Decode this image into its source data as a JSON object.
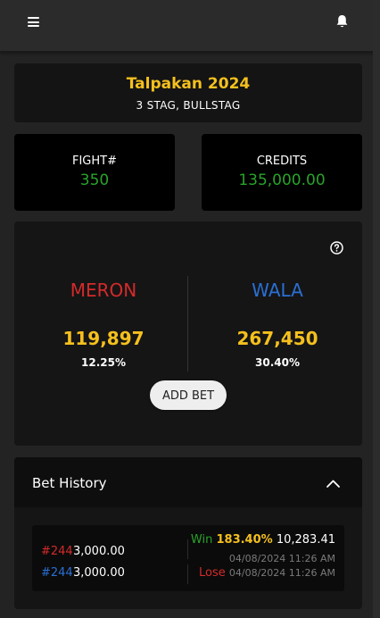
{
  "event": {
    "title": "Talpakan 2024",
    "subtitle": "3 STAG, BULLSTAG"
  },
  "stats": {
    "fight_label": "FIGHT#",
    "fight_value": "350",
    "credits_label": "CREDITS",
    "credits_value": "135,000.00"
  },
  "betting": {
    "meron": {
      "name": "MERON",
      "amount": "119,897",
      "percent": "12.25%"
    },
    "wala": {
      "name": "WALA",
      "amount": "267,450",
      "percent": "30.40%"
    },
    "add_bet_label": "ADD BET"
  },
  "history": {
    "title": "Bet History",
    "rows": [
      {
        "fight": "#244",
        "side": "meron",
        "amount": "3,000.00",
        "result": "Win",
        "percent": "183.40%",
        "payout": "10,283.41",
        "timestamp": "04/08/2024 11:26 AM"
      },
      {
        "fight": "#244",
        "side": "wala",
        "amount": "3,000.00",
        "result": "Lose",
        "timestamp": "04/08/2024 11:26 AM"
      }
    ]
  },
  "colors": {
    "gold": "#f5c01e",
    "green": "#29a329",
    "meron_red": "#d42a2a",
    "wala_blue": "#2a6fd4"
  },
  "icons": {
    "menu": "hamburger-icon",
    "notifications": "bell-icon",
    "help": "question-circle-icon",
    "collapse": "chevron-up-icon"
  }
}
